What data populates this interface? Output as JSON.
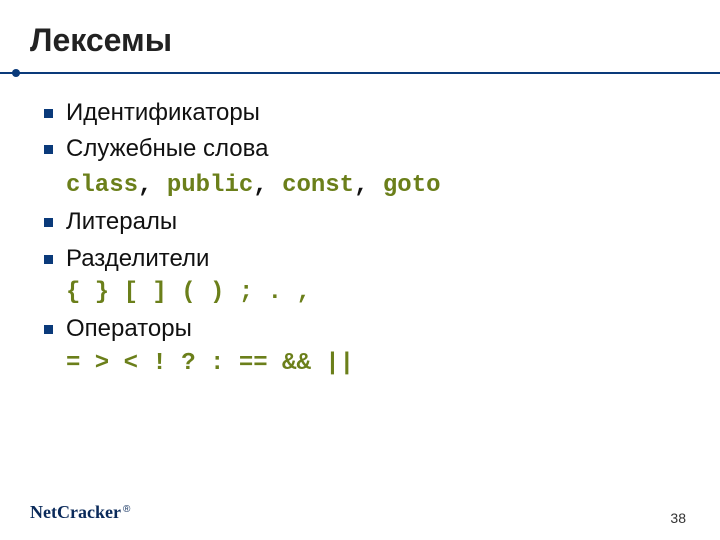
{
  "title": "Лексемы",
  "bullets": {
    "b0": {
      "label": "Идентификаторы"
    },
    "b1": {
      "label": "Служебные слова",
      "kw0": "class",
      "c0": ", ",
      "kw1": "public",
      "c1": ", ",
      "kw2": "const",
      "c2": ", ",
      "kw3": "goto"
    },
    "b2": {
      "label": "Литералы"
    },
    "b3": {
      "label": "Разделители",
      "symbols": "{ } [ ] ( ) ; . ,"
    },
    "b4": {
      "label": "Операторы",
      "symbols": "= > < ! ? : == && ||"
    }
  },
  "footer": {
    "logo_net": "Net",
    "logo_cracker": "Cracker",
    "reg": "®",
    "page": "38"
  }
}
